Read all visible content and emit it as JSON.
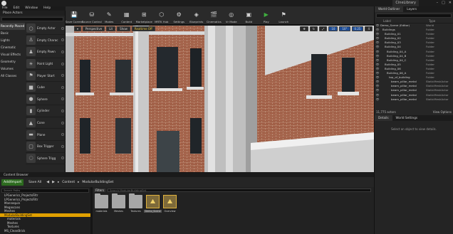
{
  "titlebar": {
    "project_tab": "CineLibrary"
  },
  "menu": [
    "File",
    "Edit",
    "Window",
    "Help"
  ],
  "place_actors": {
    "title": "Place Actors",
    "categories": [
      "Recently Placed",
      "Basic",
      "Lights",
      "Cinematic",
      "Visual Effects",
      "Geometry",
      "Volumes",
      "All Classes"
    ],
    "actors": [
      "Empty Actor",
      "Empty Charac",
      "Empty Pawn",
      "Point Light",
      "Player Start",
      "Cube",
      "Sphere",
      "Cylinder",
      "Cone",
      "Plane",
      "Box Trigger",
      "Sphere Trigg"
    ]
  },
  "toolbar": [
    {
      "label": "Save Current",
      "icon": "💾"
    },
    {
      "label": "Source Control",
      "icon": "⛁"
    },
    {
      "label": "Modes",
      "icon": "✎"
    },
    {
      "label": "Content",
      "icon": "▦"
    },
    {
      "label": "Marketplace",
      "icon": "⊞"
    },
    {
      "label": "MRTK Hub",
      "icon": "⬡"
    },
    {
      "label": "Settings",
      "icon": "⚙"
    },
    {
      "label": "Blueprints",
      "icon": "◈"
    },
    {
      "label": "Cinematics",
      "icon": "🎬"
    },
    {
      "label": "Vr Mode",
      "icon": "◎"
    },
    {
      "label": "Build",
      "icon": "▣"
    },
    {
      "label": "Play",
      "icon": "▶"
    },
    {
      "label": "Launch",
      "icon": "⚑"
    }
  ],
  "viewport": {
    "perspective": "Perspective",
    "lit": "Lit",
    "show": "Show",
    "realtime": "Realtime Off",
    "snap_values": [
      "10",
      "10°",
      "0.25",
      "4"
    ]
  },
  "outliner": {
    "tabs": [
      "World Outliner",
      "Layers"
    ],
    "col_label": "Label",
    "col_type": "Type",
    "rows": [
      {
        "name": "Demo_Scene (Editor)",
        "type": "World"
      },
      {
        "name": "Buildings",
        "type": "Folder"
      },
      {
        "name": "Building_01",
        "type": "Folder"
      },
      {
        "name": "Building_02",
        "type": "Folder"
      },
      {
        "name": "Building_03",
        "type": "Folder"
      },
      {
        "name": "Building_04",
        "type": "Folder"
      },
      {
        "name": "Building_04_A",
        "type": "Folder"
      },
      {
        "name": "Building_04_B",
        "type": "Folder"
      },
      {
        "name": "Building_04_C",
        "type": "Folder"
      },
      {
        "name": "Building_05",
        "type": "Folder"
      },
      {
        "name": "Building_06",
        "type": "Folder"
      },
      {
        "name": "Building_06_A",
        "type": "Folder"
      },
      {
        "name": "top_of_building",
        "type": "Folder"
      },
      {
        "name": "beam_pillar_metal",
        "type": "StaticMeshActor"
      },
      {
        "name": "beam_pillar_metal",
        "type": "StaticMeshActor"
      },
      {
        "name": "beam_pillar_metal",
        "type": "StaticMeshActor"
      },
      {
        "name": "beam_pillar_metal",
        "type": "StaticMeshActor"
      },
      {
        "name": "beam_pillar_metal",
        "type": "StaticMeshActor"
      }
    ],
    "count": "11,775 actors",
    "view_options": "View Options"
  },
  "details": {
    "tabs": [
      "Details",
      "World Settings"
    ],
    "message": "Select an object to view details."
  },
  "content_browser": {
    "tab": "Content Browser",
    "add_import": "Add/Import",
    "save_all": "Save All",
    "path": [
      "Content",
      "ModularBuildingSet"
    ],
    "filters": "Filters",
    "search_placeholder": "Search ModularBuildingSet",
    "search_paths": "Search Paths",
    "tree": [
      "LPGenerics_ProjectsFiltr",
      "LPGenerics_ProjectsFiltr",
      "Mannequin",
      "Megascans",
      "Meshes",
      "ModularBuildingSet",
      "materials",
      "Meshes",
      "Textures",
      "MS_CleanBrick"
    ],
    "assets": [
      "materials",
      "Meshes",
      "Textures",
      "Demo_Scene",
      "Overview"
    ]
  }
}
